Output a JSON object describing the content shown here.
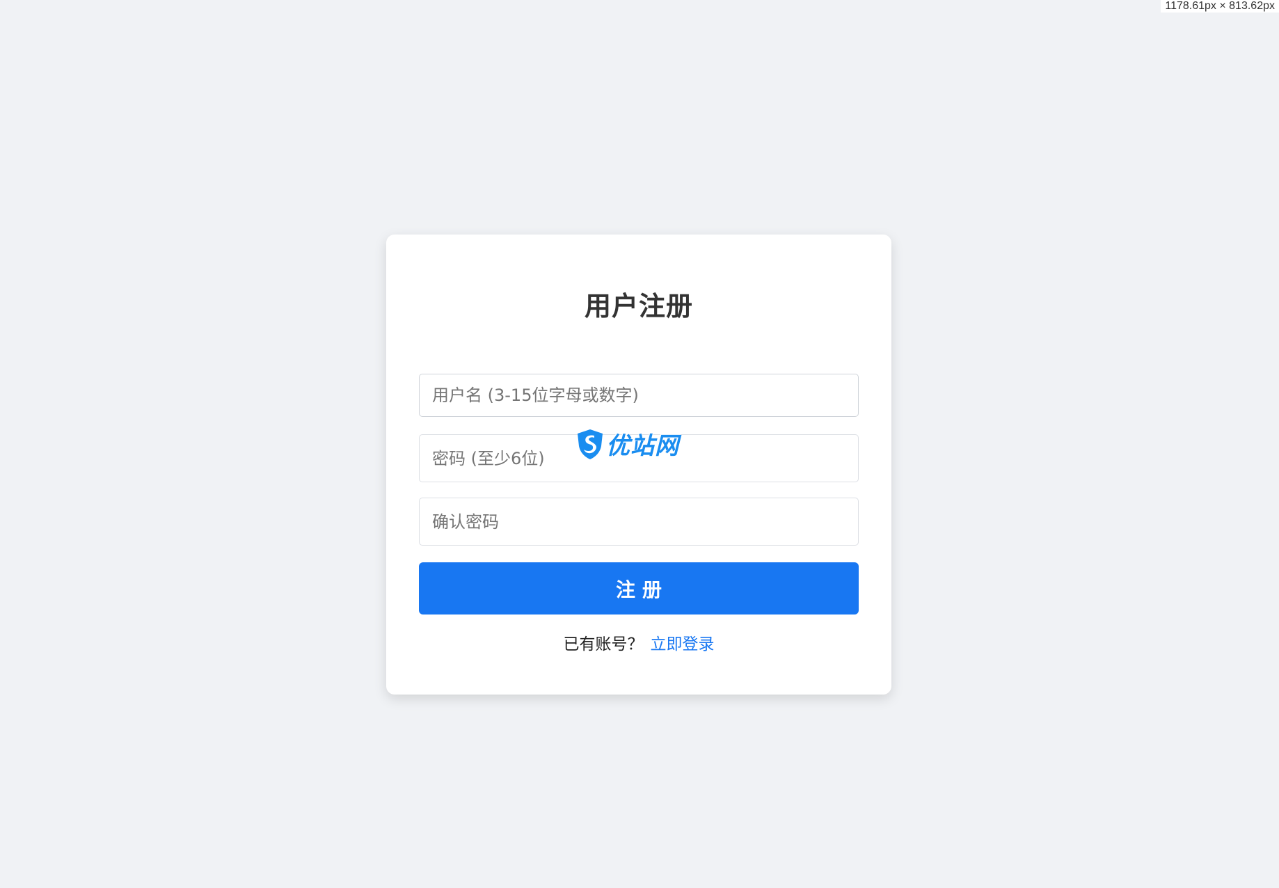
{
  "viewport_readout": "1178.61px × 813.62px",
  "form": {
    "title": "用户注册",
    "username_placeholder": "用户名 (3-15位字母或数字)",
    "password_placeholder": "密码 (至少6位)",
    "confirm_placeholder": "确认密码",
    "submit_label": "注册",
    "have_account_text": "已有账号？",
    "login_link": "立即登录"
  },
  "watermark": {
    "text": "优站网",
    "icon": "shield-logo-icon"
  },
  "colors": {
    "background": "#f0f2f5",
    "primary": "#1877f2",
    "card": "#ffffff"
  }
}
